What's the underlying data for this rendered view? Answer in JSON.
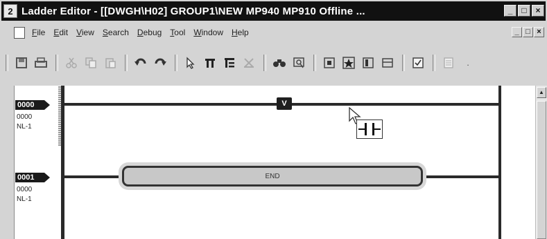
{
  "window": {
    "title": "Ladder Editor - [[DWGH\\H02]  GROUP1\\NEW  MP940  MP910    Offline ...",
    "app_icon": "2",
    "caption_buttons": [
      "_",
      "□",
      "×"
    ]
  },
  "menu": {
    "items": [
      "File",
      "Edit",
      "View",
      "Search",
      "Debug",
      "Tool",
      "Window",
      "Help"
    ],
    "mdi_buttons": [
      "_",
      "□",
      "×"
    ]
  },
  "toolbar": {
    "groups": [
      [
        "save-icon",
        "print-icon"
      ],
      [
        "cut-icon",
        "copy-icon",
        "paste-icon"
      ],
      [
        "undo-icon",
        "redo-icon"
      ],
      [
        "pointer-icon",
        "contact-tool-icon",
        "coil-tool-icon",
        "delete-tool-icon"
      ],
      [
        "find-icon",
        "zoom-icon"
      ],
      [
        "record-icon",
        "star-icon",
        "register-icon",
        "table-icon"
      ],
      [
        "check-icon"
      ],
      [
        "notes-icon"
      ]
    ]
  },
  "rungs": [
    {
      "number": "0000",
      "step": "0000",
      "label": "NL-1"
    },
    {
      "number": "0001",
      "step": "0000",
      "label": "NL-1"
    }
  ],
  "end_block": {
    "label": "END"
  },
  "rung_marker": {
    "label": "V"
  }
}
